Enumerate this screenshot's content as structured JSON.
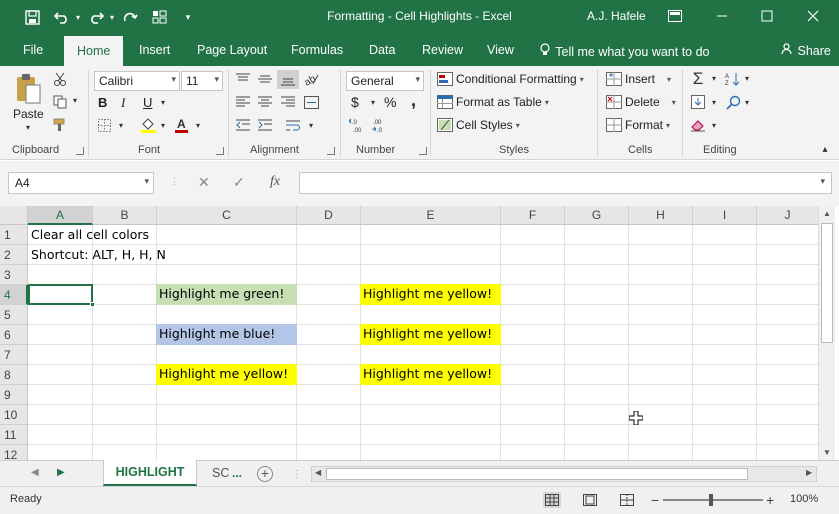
{
  "colors": {
    "accent": "#217346",
    "highlight_green": "#c6e0b4",
    "highlight_blue": "#b4c6e7",
    "highlight_yellow": "#ffff00"
  },
  "titlebar": {
    "title": "Formatting - Cell Highlights  -  Excel",
    "user": "A.J. Hafele",
    "icons": [
      "save-icon",
      "undo-icon",
      "redo-icon",
      "repeat-icon",
      "form-icon",
      "customize-icon",
      "ribbon-options-icon",
      "minimize-icon",
      "maximize-icon",
      "close-icon"
    ]
  },
  "tabs": {
    "file": "File",
    "home": "Home",
    "insert": "Insert",
    "page_layout": "Page Layout",
    "formulas": "Formulas",
    "data": "Data",
    "review": "Review",
    "view": "View",
    "tell_me": "Tell me what you want to do",
    "share": "Share"
  },
  "ribbon": {
    "clipboard": {
      "label": "Clipboard",
      "paste": "Paste"
    },
    "font": {
      "label": "Font",
      "name": "Calibri",
      "size": "11",
      "bold": "B",
      "italic": "I",
      "underline": "U"
    },
    "alignment": {
      "label": "Alignment"
    },
    "number": {
      "label": "Number",
      "format": "General",
      "currency": "$",
      "percent": "%",
      "comma": ",",
      "increase_decimal": "←.0 .00",
      "decrease_decimal": ".00 →.0"
    },
    "styles": {
      "label": "Styles",
      "conditional": "Conditional Formatting",
      "format_table": "Format as Table",
      "cell_styles": "Cell Styles"
    },
    "cells": {
      "label": "Cells",
      "insert": "Insert",
      "delete": "Delete",
      "format": "Format"
    },
    "editing": {
      "label": "Editing"
    }
  },
  "formula_bar": {
    "name_box": "A4",
    "fx": "fx",
    "content": ""
  },
  "grid": {
    "columns": [
      "A",
      "B",
      "C",
      "D",
      "E",
      "F",
      "G",
      "H",
      "I",
      "J"
    ],
    "selected_column": "A",
    "rows": [
      "1",
      "2",
      "3",
      "4",
      "5",
      "6",
      "7",
      "8",
      "9",
      "10",
      "11",
      "12"
    ],
    "selected_row": "4",
    "active_cell": "A4",
    "cells": {
      "a1": "Clear all cell colors",
      "a2": "Shortcut: ALT, H, H, N",
      "c4": "Highlight me green!",
      "e4": "Highlight me yellow!",
      "c6": "Highlight me blue!",
      "e6": "Highlight me yellow!",
      "c8": "Highlight me yellow!",
      "e8": "Highlight me yellow!"
    }
  },
  "sheets": {
    "active": "HIGHLIGHT",
    "second": "SC",
    "more": "..."
  },
  "status": {
    "ready": "Ready",
    "zoom": "100%",
    "zoom_level_percent": 100
  }
}
